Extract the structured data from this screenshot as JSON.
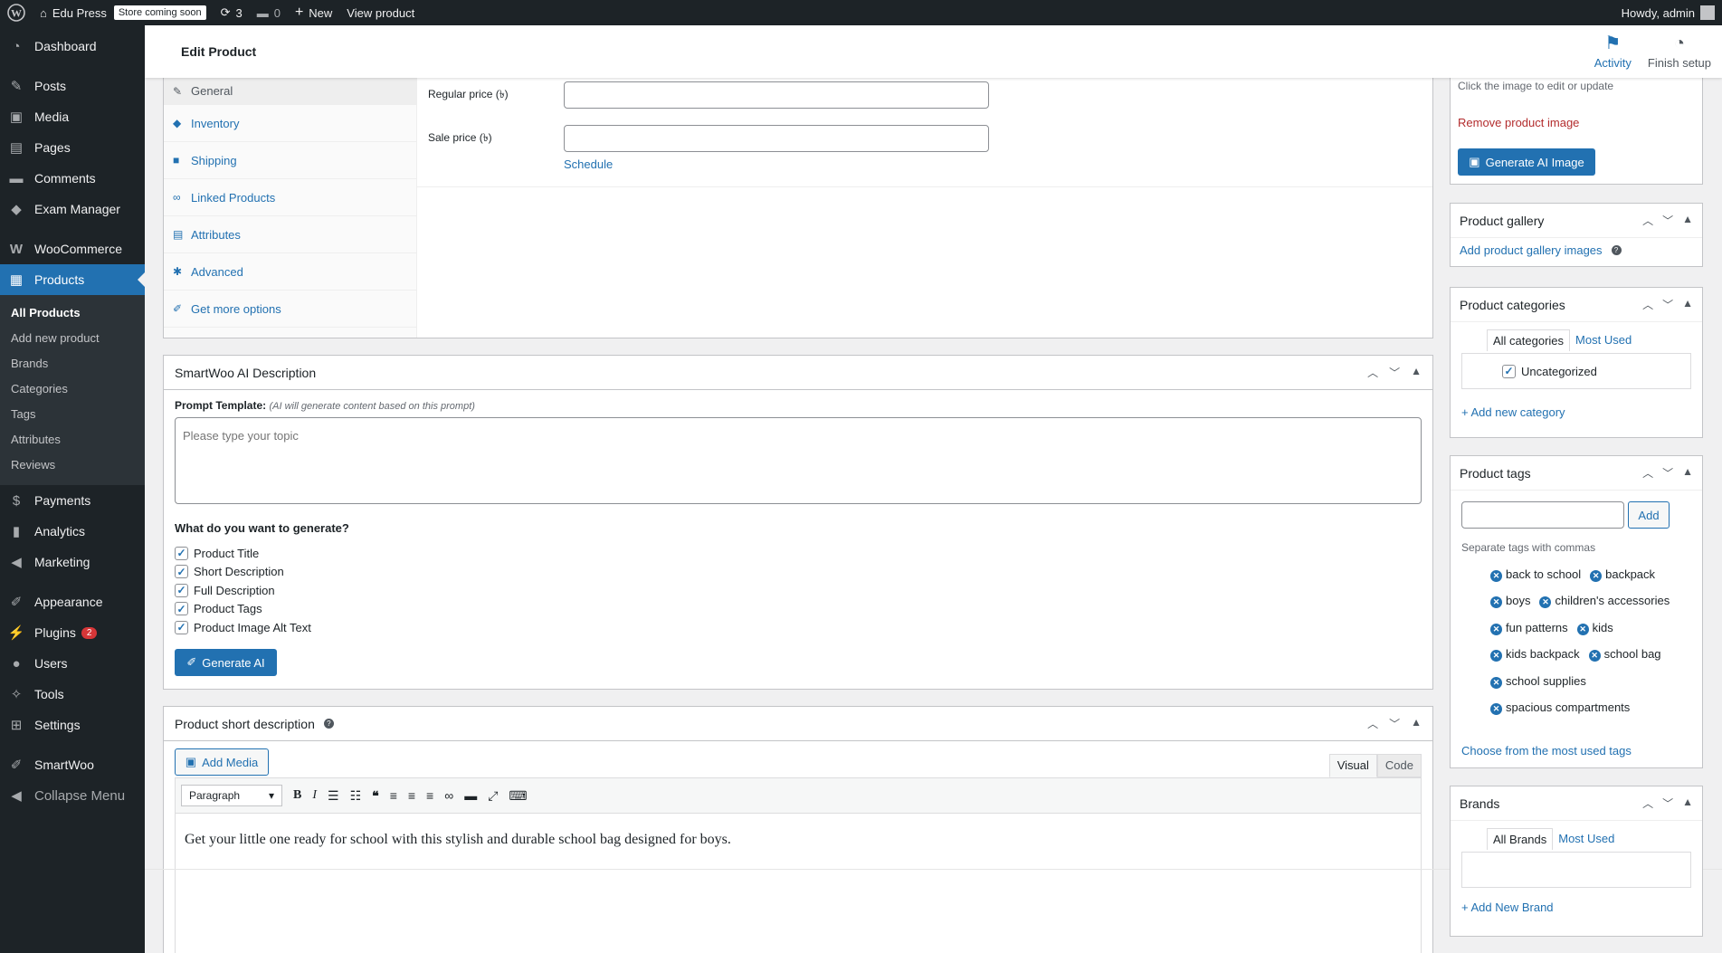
{
  "adminbar": {
    "site_name": "Edu Press",
    "store_badge": "Store coming soon",
    "updates_count": "3",
    "comments_count": "0",
    "new_label": "New",
    "view_product": "View product",
    "howdy": "Howdy, admin"
  },
  "sidebar": {
    "items": [
      {
        "label": "Dashboard",
        "icon": "dashboard-icon"
      },
      {
        "label": "Posts",
        "icon": "pin-icon"
      },
      {
        "label": "Media",
        "icon": "media-icon"
      },
      {
        "label": "Pages",
        "icon": "pages-icon"
      },
      {
        "label": "Comments",
        "icon": "comments-icon"
      },
      {
        "label": "Exam Manager",
        "icon": "mortarboard-icon"
      },
      {
        "label": "WooCommerce",
        "icon": "woo-icon"
      },
      {
        "label": "Products",
        "icon": "archive-icon"
      },
      {
        "label": "Payments",
        "icon": "payments-icon"
      },
      {
        "label": "Analytics",
        "icon": "chart-icon"
      },
      {
        "label": "Marketing",
        "icon": "megaphone-icon"
      },
      {
        "label": "Appearance",
        "icon": "brush-icon"
      },
      {
        "label": "Plugins",
        "icon": "plugin-icon",
        "badge": "2"
      },
      {
        "label": "Users",
        "icon": "user-icon"
      },
      {
        "label": "Tools",
        "icon": "wrench-icon"
      },
      {
        "label": "Settings",
        "icon": "settings-icon"
      },
      {
        "label": "SmartWoo",
        "icon": "brush-icon"
      },
      {
        "label": "Collapse Menu",
        "icon": "collapse-icon"
      }
    ],
    "submenu": [
      "All Products",
      "Add new product",
      "Brands",
      "Categories",
      "Tags",
      "Attributes",
      "Reviews"
    ]
  },
  "header": {
    "title": "Edit Product",
    "activity": "Activity",
    "finish_setup": "Finish setup"
  },
  "product_data": {
    "tabs": [
      "General",
      "Inventory",
      "Shipping",
      "Linked Products",
      "Attributes",
      "Advanced",
      "Get more options"
    ],
    "regular_price_label": "Regular price (৳)",
    "sale_price_label": "Sale price (৳)",
    "schedule": "Schedule"
  },
  "smartwoo": {
    "title": "SmartWoo AI Description",
    "prompt_label": "Prompt Template:",
    "prompt_hint": "(AI will generate content based on this prompt)",
    "prompt_placeholder": "Please type your topic",
    "question": "What do you want to generate?",
    "options": [
      "Product Title",
      "Short Description",
      "Full Description",
      "Product Tags",
      "Product Image Alt Text"
    ],
    "generate_button": "Generate AI"
  },
  "short_description": {
    "title": "Product short description",
    "add_media": "Add Media",
    "visual_tab": "Visual",
    "code_tab": "Code",
    "format": "Paragraph",
    "content": "Get your little one ready for school with this stylish and durable school bag designed for boys."
  },
  "product_image": {
    "hint": "Click the image to edit or update",
    "remove": "Remove product image",
    "generate": "Generate AI Image"
  },
  "gallery": {
    "title": "Product gallery",
    "add_link": "Add product gallery images"
  },
  "categories": {
    "title": "Product categories",
    "tab_all": "All categories",
    "tab_most": "Most Used",
    "items": [
      "Uncategorized"
    ],
    "add_link": "+ Add new category"
  },
  "tags": {
    "title": "Product tags",
    "add_button": "Add",
    "hint": "Separate tags with commas",
    "rows": [
      [
        "back to school",
        "backpack"
      ],
      [
        "boys",
        "children's accessories"
      ],
      [
        "fun patterns",
        "kids"
      ],
      [
        "kids backpack",
        "school bag"
      ],
      [
        "school supplies"
      ],
      [
        "spacious compartments"
      ]
    ],
    "choose_link": "Choose from the most used tags"
  },
  "brands": {
    "title": "Brands",
    "tab_all": "All Brands",
    "tab_most": "Most Used",
    "add_link": "+ Add New Brand"
  },
  "colors": {
    "accent": "#2271b1",
    "adminbar": "#1d2327",
    "badge": "#d63638"
  }
}
